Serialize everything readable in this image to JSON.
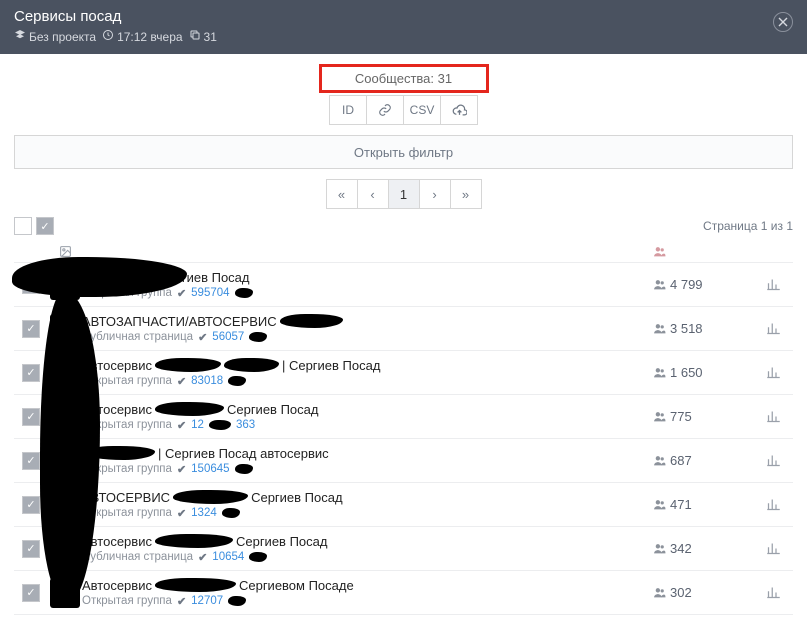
{
  "header": {
    "title": "Сервисы посад",
    "project": "Без проекта",
    "time": "17:12 вчера",
    "count_badge": "31"
  },
  "count_label": "Сообщества: 31",
  "buttons": {
    "id": "ID",
    "link": "🔗",
    "csv": "CSV",
    "cloud": "⇪"
  },
  "filter_label": "Открыть фильтр",
  "pager": {
    "first": "«",
    "prev": "‹",
    "current": "1",
    "next": "›",
    "last": "»"
  },
  "page_of": "Страница 1 из 1",
  "table_head": {
    "image": "🖼",
    "members": "👥"
  },
  "rows": [
    {
      "title_before": "",
      "title_after": "Сергиев Посад",
      "type": "Открытая группа",
      "vk_id": "595704",
      "members": "4 799"
    },
    {
      "title_before": "АВТОЗАПЧАСТИ/АВТОСЕРВИС",
      "title_after": "",
      "type": "Публичная страница",
      "vk_id": "56057",
      "members": "3 518"
    },
    {
      "title_before": "Автосервис",
      "title_mid": "",
      "title_after": "| Сергиев Посад",
      "type": "Открытая группа",
      "vk_id": "83018",
      "members": "1 650"
    },
    {
      "title_before": "Автосервис",
      "title_after": "Сергиев Посад",
      "type": "Открытая группа",
      "vk_id_pre": "12",
      "vk_id_post": "363",
      "members": "775"
    },
    {
      "title_before": "",
      "title_after": "| Сергиев Посад автосервис",
      "type": "Открытая группа",
      "vk_id": "150645",
      "members": "687"
    },
    {
      "title_before": "АВТОСЕРВИС",
      "title_after": "Сергиев Посад",
      "type": "Открытая группа",
      "vk_id": "1324",
      "members": "471"
    },
    {
      "title_before": "Автосервис",
      "title_after": "Сергиев Посад",
      "type": "Публичная страница",
      "vk_id": "10654",
      "members": "342"
    },
    {
      "title_before": "Автосервис",
      "title_after": "Сергиевом Посаде",
      "type": "Открытая группа",
      "vk_id": "12707",
      "members": "302"
    }
  ]
}
